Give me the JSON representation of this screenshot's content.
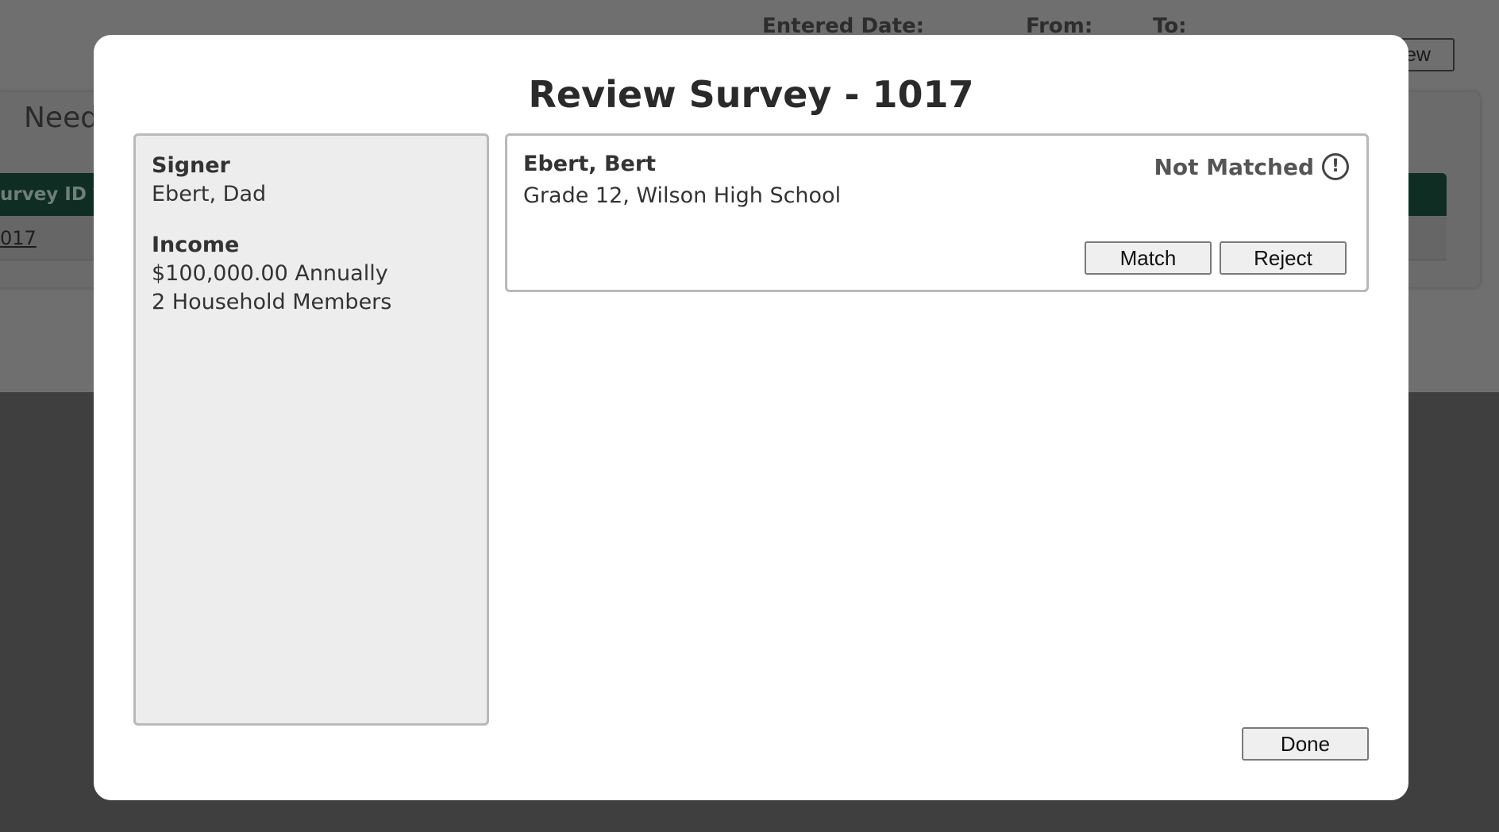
{
  "background": {
    "filter_labels": [
      "Entered Date:",
      "From:",
      "To:"
    ],
    "view_button_label": "ew",
    "section_title": "Needs",
    "column_header": "urvey ID ▼",
    "row_link": "017"
  },
  "modal": {
    "title": "Review Survey - 1017",
    "signer": {
      "label": "Signer",
      "value": "Ebert, Dad"
    },
    "income": {
      "label": "Income",
      "amount": "$100,000.00 Annually",
      "household": "2 Household Members"
    },
    "student": {
      "name": "Ebert, Bert",
      "detail": "Grade 12, Wilson High School",
      "status": "Not Matched",
      "status_icon": "exclamation-circle-icon",
      "match_label": "Match",
      "reject_label": "Reject"
    },
    "done_label": "Done"
  },
  "colors": {
    "overlay_top": "#6f6f6f",
    "overlay_bottom": "#3f3f3f",
    "table_header": "#0f2d22",
    "panel_bg": "#ededed",
    "panel_border": "#b9b9b9"
  }
}
